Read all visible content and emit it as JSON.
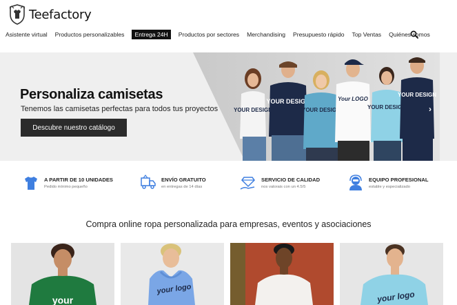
{
  "brand": {
    "name": "Teefactory",
    "logo_icon": "shield-crest-icon"
  },
  "nav": {
    "items": [
      {
        "label": "Asistente virtual",
        "highlight": false
      },
      {
        "label": "Productos personalizables",
        "highlight": false
      },
      {
        "label": "Entrega 24H",
        "highlight": true
      },
      {
        "label": "Productos por sectores",
        "highlight": false
      },
      {
        "label": "Merchandising",
        "highlight": false
      },
      {
        "label": "Presupuesto rápido",
        "highlight": false
      },
      {
        "label": "Top Ventas",
        "highlight": false
      },
      {
        "label": "Quiénes somos",
        "highlight": false
      }
    ],
    "search_icon": "search-icon"
  },
  "hero": {
    "title": "Personaliza camisetas",
    "subtitle": "Tenemos las camisetas perfectas para todos tus proyectos",
    "cta_label": "Descubre nuestro catálogo",
    "next_icon": "chevron-right-icon",
    "shirt_prints": [
      "YOUR DESIGN",
      "YOUR DESIGN",
      "YOUR DESIGN",
      "Your LOGO",
      "YOUR DESIGN",
      "YOUR DESIGN"
    ]
  },
  "features": [
    {
      "title": "A PARTIR DE 10 UNIDADES",
      "subtitle": "Pedido mínimo pequeño",
      "icon": "tshirt-icon"
    },
    {
      "title": "ENVÍO GRATUITO",
      "subtitle": "en entregas de 14 días",
      "icon": "delivery-truck-icon"
    },
    {
      "title": "SERVICIO DE CALIDAD",
      "subtitle": "nos valorais con un 4.5/5",
      "icon": "diamond-hand-icon"
    },
    {
      "title": "EQUIPO PROFESIONAL",
      "subtitle": "estable y especializado",
      "icon": "support-agent-icon"
    }
  ],
  "section": {
    "title": "Compra online ropa personalizada para empresas, eventos y asociaciones"
  },
  "products": [
    {
      "print": "your",
      "icon": "green-tshirt-model"
    },
    {
      "print": "your logo",
      "icon": "blue-hoodie-model"
    },
    {
      "print": "",
      "icon": "white-tshirt-model"
    },
    {
      "print": "your logo",
      "icon": "lightblue-tshirt-model"
    }
  ],
  "colors": {
    "accent_blue": "#3f7fe0",
    "dark": "#2b2b2b",
    "green_shirt": "#1f7a3f",
    "hoodie_blue": "#7aa6e6",
    "light_blue_shirt": "#8fd2e6",
    "navy_shirt": "#1d2a48",
    "teal_shirt": "#5fa9c9"
  }
}
